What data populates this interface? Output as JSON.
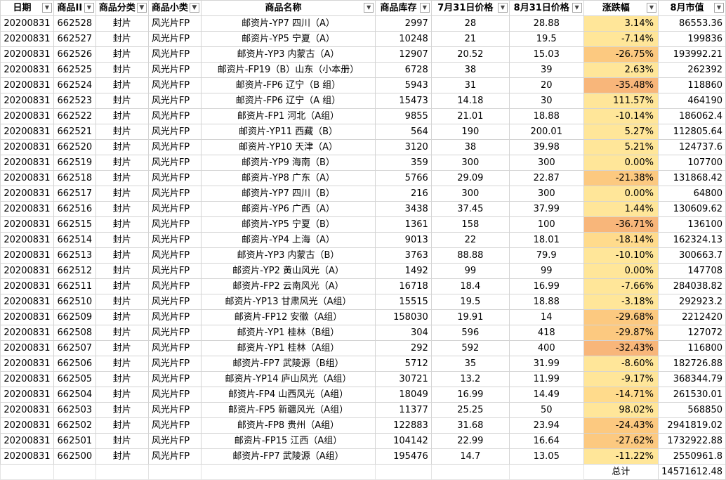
{
  "headers": [
    "日期",
    "商品II",
    "商品分类",
    "商品小类",
    "商品名称",
    "商品库存",
    "7月31日价格",
    "8月31日价格",
    "涨跌幅",
    "8月市值"
  ],
  "rows": [
    [
      "20200831",
      "662528",
      "封片",
      "风光片FP",
      "邮资片-YP7 四川（A）",
      "2997",
      "28",
      "28.88",
      "3.14%",
      "86553.36"
    ],
    [
      "20200831",
      "662527",
      "封片",
      "风光片FP",
      "邮资片-YP5 宁夏（A）",
      "10248",
      "21",
      "19.5",
      "-7.14%",
      "199836"
    ],
    [
      "20200831",
      "662526",
      "封片",
      "风光片FP",
      "邮资片-YP3 内蒙古（A）",
      "12907",
      "20.52",
      "15.03",
      "-26.75%",
      "193992.21"
    ],
    [
      "20200831",
      "662525",
      "封片",
      "风光片FP",
      "邮资片-FP19（B）山东（小本册）",
      "6728",
      "38",
      "39",
      "2.63%",
      "262392"
    ],
    [
      "20200831",
      "662524",
      "封片",
      "风光片FP",
      "邮资片-FP6 辽宁（B 组）",
      "5943",
      "31",
      "20",
      "-35.48%",
      "118860"
    ],
    [
      "20200831",
      "662523",
      "封片",
      "风光片FP",
      "邮资片-FP6 辽宁（A 组）",
      "15473",
      "14.18",
      "30",
      "111.57%",
      "464190"
    ],
    [
      "20200831",
      "662522",
      "封片",
      "风光片FP",
      "邮资片-FP1 河北（A组）",
      "9855",
      "21.01",
      "18.88",
      "-10.14%",
      "186062.4"
    ],
    [
      "20200831",
      "662521",
      "封片",
      "风光片FP",
      "邮资片-YP11 西藏（B）",
      "564",
      "190",
      "200.01",
      "5.27%",
      "112805.64"
    ],
    [
      "20200831",
      "662520",
      "封片",
      "风光片FP",
      "邮资片-YP10 天津（A）",
      "3120",
      "38",
      "39.98",
      "5.21%",
      "124737.6"
    ],
    [
      "20200831",
      "662519",
      "封片",
      "风光片FP",
      "邮资片-YP9 海南（B）",
      "359",
      "300",
      "300",
      "0.00%",
      "107700"
    ],
    [
      "20200831",
      "662518",
      "封片",
      "风光片FP",
      "邮资片-YP8 广东（A）",
      "5766",
      "29.09",
      "22.87",
      "-21.38%",
      "131868.42"
    ],
    [
      "20200831",
      "662517",
      "封片",
      "风光片FP",
      "邮资片-YP7 四川（B）",
      "216",
      "300",
      "300",
      "0.00%",
      "64800"
    ],
    [
      "20200831",
      "662516",
      "封片",
      "风光片FP",
      "邮资片-YP6 广西（A）",
      "3438",
      "37.45",
      "37.99",
      "1.44%",
      "130609.62"
    ],
    [
      "20200831",
      "662515",
      "封片",
      "风光片FP",
      "邮资片-YP5 宁夏（B）",
      "1361",
      "158",
      "100",
      "-36.71%",
      "136100"
    ],
    [
      "20200831",
      "662514",
      "封片",
      "风光片FP",
      "邮资片-YP4 上海（A）",
      "9013",
      "22",
      "18.01",
      "-18.14%",
      "162324.13"
    ],
    [
      "20200831",
      "662513",
      "封片",
      "风光片FP",
      "邮资片-YP3 内蒙古（B）",
      "3763",
      "88.88",
      "79.9",
      "-10.10%",
      "300663.7"
    ],
    [
      "20200831",
      "662512",
      "封片",
      "风光片FP",
      "邮资片-YP2 黄山风光（A）",
      "1492",
      "99",
      "99",
      "0.00%",
      "147708"
    ],
    [
      "20200831",
      "662511",
      "封片",
      "风光片FP",
      "邮资片-FP2 云南风光（A）",
      "16718",
      "18.4",
      "16.99",
      "-7.66%",
      "284038.82"
    ],
    [
      "20200831",
      "662510",
      "封片",
      "风光片FP",
      "邮资片-YP13 甘肃风光（A组）",
      "15515",
      "19.5",
      "18.88",
      "-3.18%",
      "292923.2"
    ],
    [
      "20200831",
      "662509",
      "封片",
      "风光片FP",
      "邮资片-FP12 安徽（A组）",
      "158030",
      "19.91",
      "14",
      "-29.68%",
      "2212420"
    ],
    [
      "20200831",
      "662508",
      "封片",
      "风光片FP",
      "邮资片-YP1 桂林（B组）",
      "304",
      "596",
      "418",
      "-29.87%",
      "127072"
    ],
    [
      "20200831",
      "662507",
      "封片",
      "风光片FP",
      "邮资片-YP1 桂林（A组）",
      "292",
      "592",
      "400",
      "-32.43%",
      "116800"
    ],
    [
      "20200831",
      "662506",
      "封片",
      "风光片FP",
      "邮资片-FP7 武陵源（B组）",
      "5712",
      "35",
      "31.99",
      "-8.60%",
      "182726.88"
    ],
    [
      "20200831",
      "662505",
      "封片",
      "风光片FP",
      "邮资片-YP14 庐山风光（A组）",
      "30721",
      "13.2",
      "11.99",
      "-9.17%",
      "368344.79"
    ],
    [
      "20200831",
      "662504",
      "封片",
      "风光片FP",
      "邮资片-FP4 山西风光（A组）",
      "18049",
      "16.99",
      "14.49",
      "-14.71%",
      "261530.01"
    ],
    [
      "20200831",
      "662503",
      "封片",
      "风光片FP",
      "邮资片-FP5 新疆风光（A组）",
      "11377",
      "25.25",
      "50",
      "98.02%",
      "568850"
    ],
    [
      "20200831",
      "662502",
      "封片",
      "风光片FP",
      "邮资片-FP8 贵州（A组）",
      "122883",
      "31.68",
      "23.94",
      "-24.43%",
      "2941819.02"
    ],
    [
      "20200831",
      "662501",
      "封片",
      "风光片FP",
      "邮资片-FP15 江西（A组）",
      "104142",
      "22.99",
      "16.64",
      "-27.62%",
      "1732922.88"
    ],
    [
      "20200831",
      "662500",
      "封片",
      "风光片FP",
      "邮资片-FP7 武陵源（A组）",
      "195476",
      "14.7",
      "13.05",
      "-11.22%",
      "2550961.8"
    ]
  ],
  "total_label": "总计",
  "total_value": "14571612.48",
  "colors": {
    "pct_yellow": "#ffe699",
    "pct_light": "#ffdb8c",
    "pct_mid": "#fcc980",
    "pct_dark": "#f8b67a",
    "grid": "#d4d4d4"
  }
}
